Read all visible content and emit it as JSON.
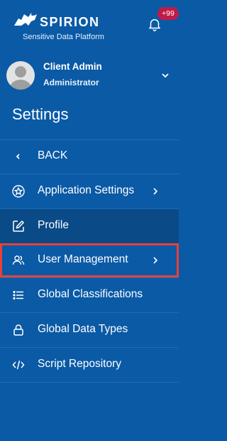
{
  "brand": {
    "name": "SPIRION",
    "tagline": "Sensitive Data Platform"
  },
  "notifications": {
    "badge": "+99",
    "icon": "bell-icon"
  },
  "user": {
    "name": "Client Admin",
    "role": "Administrator"
  },
  "page": {
    "title": "Settings"
  },
  "menu": {
    "items": [
      {
        "label": "BACK",
        "icon": "chevron-left-icon"
      },
      {
        "label": "Application Settings",
        "icon": "star-badge-icon",
        "has_submenu": true
      },
      {
        "label": "Profile",
        "icon": "edit-icon",
        "active": true
      },
      {
        "label": "User Management",
        "icon": "users-icon",
        "has_submenu": true,
        "highlighted": true
      },
      {
        "label": "Global Classifications",
        "icon": "list-icon"
      },
      {
        "label": "Global Data Types",
        "icon": "lock-icon"
      },
      {
        "label": "Script Repository",
        "icon": "code-icon"
      }
    ]
  },
  "colors": {
    "sidebar_bg": "#0a5aa6",
    "active_bg": "#0a4a87",
    "badge_bg": "#c01b48",
    "highlight_border": "#e8413a",
    "text": "#ffffff"
  }
}
